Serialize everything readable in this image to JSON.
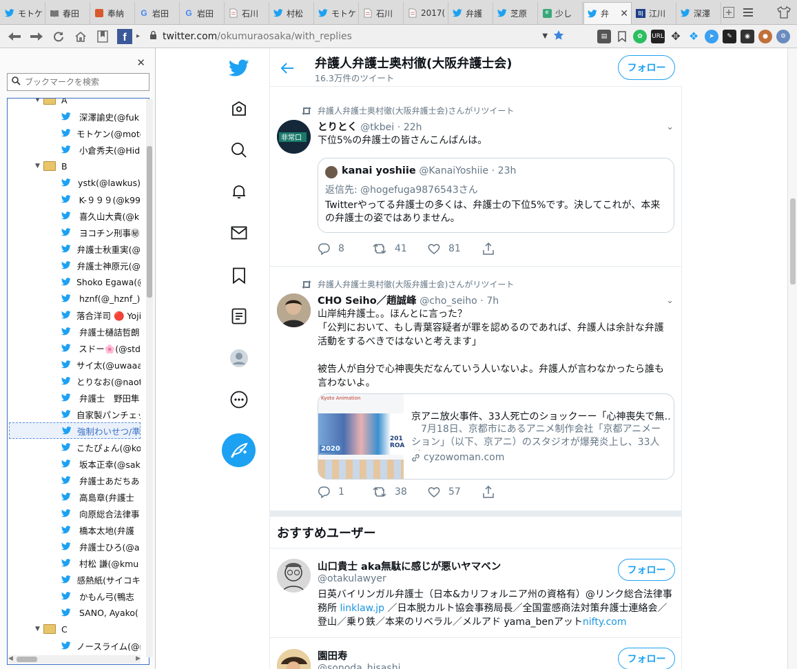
{
  "browser": {
    "tabs": [
      {
        "title": "モトケ",
        "icon": "twitter"
      },
      {
        "title": "春田",
        "icon": "book"
      },
      {
        "title": "奉納",
        "icon": "shop"
      },
      {
        "title": "岩田",
        "icon": "google"
      },
      {
        "title": "岩田",
        "icon": "google"
      },
      {
        "title": "石川",
        "icon": "page"
      },
      {
        "title": "村松",
        "icon": "twitter"
      },
      {
        "title": "モトケ",
        "icon": "twitter"
      },
      {
        "title": "石川",
        "icon": "page"
      },
      {
        "title": "2017(",
        "icon": "page"
      },
      {
        "title": "弁護",
        "icon": "twitter"
      },
      {
        "title": "芝原",
        "icon": "twitter"
      },
      {
        "title": "少し",
        "icon": "green"
      },
      {
        "title": "弁",
        "icon": "twitter",
        "active": true
      },
      {
        "title": "江川",
        "icon": "bj"
      },
      {
        "title": "深澤",
        "icon": "twitter"
      }
    ],
    "url_host": "twitter.com",
    "url_path": "/okumuraosaka/with_replies"
  },
  "sidebar": {
    "search_placeholder": "ブックマークを検索",
    "tree": [
      {
        "type": "folder",
        "label": "A",
        "level": 0
      },
      {
        "type": "item",
        "label": "深澤諭史(@fuk",
        "level": 1
      },
      {
        "type": "item",
        "label": "モトケン(@moto",
        "level": 1
      },
      {
        "type": "item",
        "label": "小倉秀夫(@Hid",
        "level": 1
      },
      {
        "type": "folder",
        "label": "B",
        "level": 0
      },
      {
        "type": "item",
        "label": "ystk(@lawkus)",
        "level": 1
      },
      {
        "type": "item",
        "label": "K-９９９(@k99",
        "level": 1
      },
      {
        "type": "item",
        "label": "喜久山大貴(@k",
        "level": 1
      },
      {
        "type": "item",
        "label": "ヨコチン刑事㊙",
        "level": 1
      },
      {
        "type": "item",
        "label": "弁護士秋重実(@",
        "level": 1
      },
      {
        "type": "item",
        "label": "弁護士神原元(@",
        "level": 1
      },
      {
        "type": "item",
        "label": "Shoko Egawa(@",
        "level": 1
      },
      {
        "type": "item",
        "label": "hznf(@_hznf_)",
        "level": 1
      },
      {
        "type": "item",
        "label": "落合洋司 🔴 Yoji",
        "level": 1
      },
      {
        "type": "item",
        "label": "弁護士樋詰哲朗",
        "level": 1
      },
      {
        "type": "item",
        "label": "スドー🌸(@std",
        "level": 1
      },
      {
        "type": "item",
        "label": "サイ太(@uwaaa",
        "level": 1
      },
      {
        "type": "item",
        "label": "とりなお(@naot",
        "level": 1
      },
      {
        "type": "item",
        "label": "弁護士　野田隼",
        "level": 1
      },
      {
        "type": "item",
        "label": "自家製パンチェッ",
        "level": 1
      },
      {
        "type": "item",
        "label": "強制わいせつ/準",
        "level": 1,
        "selected": true
      },
      {
        "type": "item",
        "label": "こたぴょん(@ko",
        "level": 1
      },
      {
        "type": "item",
        "label": "坂本正幸(@sak",
        "level": 1
      },
      {
        "type": "item",
        "label": "弁護士あだちあ",
        "level": 1
      },
      {
        "type": "item",
        "label": "高島章(弁護士",
        "level": 1
      },
      {
        "type": "item",
        "label": "向原総合法律事",
        "level": 1
      },
      {
        "type": "item",
        "label": "橋本太地(弁護",
        "level": 1
      },
      {
        "type": "item",
        "label": "弁護士ひろ(@a",
        "level": 1
      },
      {
        "type": "item",
        "label": "村松 謙(@kmu",
        "level": 1
      },
      {
        "type": "item",
        "label": "感熱紙(サイコキ",
        "level": 1
      },
      {
        "type": "item",
        "label": "かもん弓(鴨志",
        "level": 1
      },
      {
        "type": "item",
        "label": "SANO, Ayako(",
        "level": 1
      },
      {
        "type": "folder",
        "label": "C",
        "level": 0
      },
      {
        "type": "item",
        "label": "ノースライム(@n",
        "level": 1
      }
    ]
  },
  "header": {
    "name": "弁護人弁護士奥村徹(大阪弁護士会)",
    "tweet_count": "16.3万件のツイート",
    "follow_label": "フォロー"
  },
  "tweets": [
    {
      "retweet_label": "弁護人弁護士奥村徹(大阪弁護士会)さんがリツイート",
      "name": "とりとく",
      "handle": "@tkbei",
      "time": "22h",
      "text": "下位5%の弁護士の皆さんこんばんは。",
      "quote": {
        "name": "kanai yoshiie",
        "handle": "@KanaiYoshiie",
        "time": "23h",
        "reply_to": "返信先: @hogefuga9876543さん",
        "text": "Twitterやってる弁護士の多くは、弁護士の下位5%です。決してこれが、本来の弁護士の姿ではありません。"
      },
      "replies": "8",
      "retweets": "41",
      "likes": "81"
    },
    {
      "retweet_label": "弁護人弁護士奥村徹(大阪弁護士会)さんがリツイート",
      "name": "CHO Seiho／趙誠峰",
      "handle": "@cho_seiho",
      "time": "7h",
      "text": "山岸純弁護士。。ほんとに言った？\n「公判において、もし青葉容疑者が罪を認めるのであれば、弁護人は余計な弁護活動をするべきではないと考えます」\n\n被告人が自分で心神喪失だなんていう人いないよ。弁護人が言わなかったら誰も言わないよ。",
      "card": {
        "title": "京アニ放火事件、33人死亡のショックーー「心神喪失で無…",
        "desc": "7月18日、京都市にあるアニメ制作会社「京都アニメーション」（以下、京アニ）のスタジオが爆発炎上し、33人が死…",
        "domain": "cyzowoman.com",
        "img_label": "Kyoto Animation",
        "img_year": "2020",
        "img_text": "201 ROA"
      },
      "replies": "1",
      "retweets": "38",
      "likes": "57"
    }
  ],
  "recommended": {
    "heading": "おすすめユーザー",
    "users": [
      {
        "name": "山口貴士 aka無駄に感じが悪いヤマベン",
        "handle": "@otakulawyer",
        "bio_1": "日英バイリンガル弁護士（日本&カリフォルニア州の資格有）@リンク総合法律事務所 ",
        "bio_link1": "linklaw.jp",
        "bio_2": " ／日本脱カルト協会事務局長／全国霊感商法対策弁護士連絡会／登山／乗り鉄／本来のリベラル／メルアド yama_benアット",
        "bio_link2": "nifty.com",
        "follow_label": "フォロー"
      },
      {
        "name": "園田寿",
        "handle": "@sonoda_hisashi",
        "follow_label": "フォロー"
      }
    ]
  },
  "colors": {
    "twitter_blue": "#1da1f2",
    "text_secondary": "#657786",
    "border": "#e6ecf0"
  }
}
